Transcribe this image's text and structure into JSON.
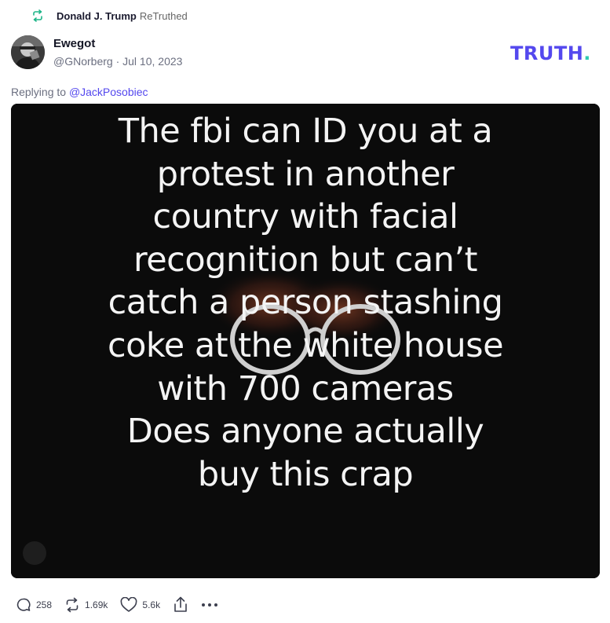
{
  "retruth": {
    "user": "Donald J. Trump",
    "action": "ReTruthed"
  },
  "post": {
    "author_name": "Ewegot",
    "handle": "@GNorberg",
    "separator": "·",
    "date": "Jul 10, 2023",
    "reply_prefix": "Replying to",
    "reply_to": "@JackPosobiec",
    "image_text_lines": [
      "The fbi can ID you at a",
      "protest in another",
      "country with facial",
      "recognition but can’t",
      "catch a person stashing",
      "coke at the white house",
      "with 700 cameras",
      "Does anyone actually",
      "buy this crap"
    ]
  },
  "logo": {
    "text": "TRUTH",
    "dot": "."
  },
  "stats": {
    "replies": "258",
    "retruths": "1.69k",
    "likes": "5.6k"
  },
  "icons": {
    "retruth": "retruth-arrows-icon",
    "reply": "comment-bubble-icon",
    "like": "heart-icon",
    "share": "share-upload-icon",
    "more": "more-dots-icon"
  },
  "colors": {
    "brand": "#5448ee",
    "brand_dot": "#2fcbb0",
    "retruth_green": "#1fb589",
    "meta_gray": "#6b6f80"
  }
}
